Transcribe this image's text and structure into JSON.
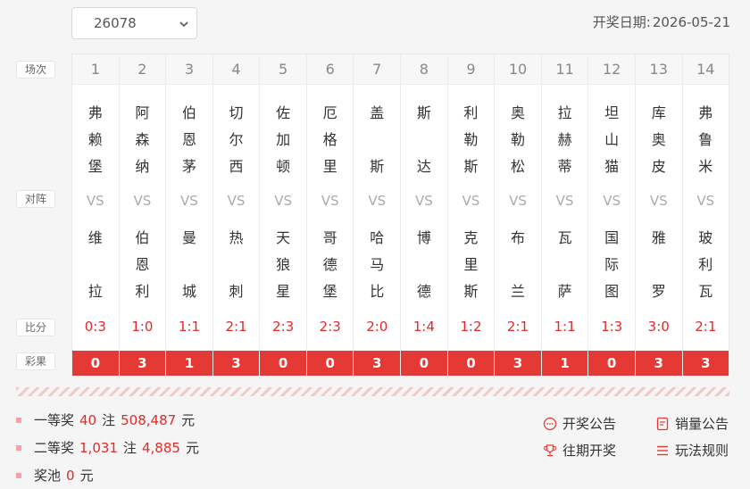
{
  "issue_select": {
    "value": "26078"
  },
  "draw_date": {
    "label": "开奖日期:",
    "value": "2026-05-21"
  },
  "row_labels": {
    "match_no": "场次",
    "matchup": "对阵",
    "score": "比分",
    "result": "彩果"
  },
  "vs_text": "VS",
  "matches": [
    {
      "no": "1",
      "home": [
        "弗",
        "赖",
        "堡"
      ],
      "away": [
        "维",
        "",
        "拉"
      ],
      "score": "0:3",
      "result": "0"
    },
    {
      "no": "2",
      "home": [
        "阿",
        "森",
        "纳"
      ],
      "away": [
        "伯",
        "恩",
        "利"
      ],
      "score": "1:0",
      "result": "3"
    },
    {
      "no": "3",
      "home": [
        "伯",
        "恩",
        "茅"
      ],
      "away": [
        "曼",
        "",
        "城"
      ],
      "score": "1:1",
      "result": "1"
    },
    {
      "no": "4",
      "home": [
        "切",
        "尔",
        "西"
      ],
      "away": [
        "热",
        "",
        "刺"
      ],
      "score": "2:1",
      "result": "3"
    },
    {
      "no": "5",
      "home": [
        "佐",
        "加",
        "顿"
      ],
      "away": [
        "天",
        "狼",
        "星"
      ],
      "score": "2:3",
      "result": "0"
    },
    {
      "no": "6",
      "home": [
        "厄",
        "格",
        "里"
      ],
      "away": [
        "哥",
        "德",
        "堡"
      ],
      "score": "2:3",
      "result": "0"
    },
    {
      "no": "7",
      "home": [
        "盖",
        "",
        "斯"
      ],
      "away": [
        "哈",
        "马",
        "比"
      ],
      "score": "2:0",
      "result": "3"
    },
    {
      "no": "8",
      "home": [
        "斯",
        "",
        "达"
      ],
      "away": [
        "博",
        "",
        "德"
      ],
      "score": "1:4",
      "result": "0"
    },
    {
      "no": "9",
      "home": [
        "利",
        "勒",
        "斯"
      ],
      "away": [
        "克",
        "里",
        "斯"
      ],
      "score": "1:2",
      "result": "0"
    },
    {
      "no": "10",
      "home": [
        "奥",
        "勒",
        "松"
      ],
      "away": [
        "布",
        "",
        "兰"
      ],
      "score": "2:1",
      "result": "3"
    },
    {
      "no": "11",
      "home": [
        "拉",
        "赫",
        "蒂"
      ],
      "away": [
        "瓦",
        "",
        "萨"
      ],
      "score": "1:1",
      "result": "1"
    },
    {
      "no": "12",
      "home": [
        "坦",
        "山",
        "猫"
      ],
      "away": [
        "国",
        "际",
        "图"
      ],
      "score": "1:3",
      "result": "0"
    },
    {
      "no": "13",
      "home": [
        "库",
        "奥",
        "皮"
      ],
      "away": [
        "雅",
        "",
        "罗"
      ],
      "score": "3:0",
      "result": "3"
    },
    {
      "no": "14",
      "home": [
        "弗",
        "鲁",
        "米"
      ],
      "away": [
        "玻",
        "利",
        "瓦"
      ],
      "score": "2:1",
      "result": "3"
    }
  ],
  "prizes": {
    "first": {
      "label": "一等奖",
      "count": "40",
      "unit_count": "注",
      "amount": "508,487",
      "unit_amount": "元"
    },
    "second": {
      "label": "二等奖",
      "count": "1,031",
      "unit_count": "注",
      "amount": "4,885",
      "unit_amount": "元"
    },
    "pool": {
      "label": "奖池",
      "amount": "0",
      "unit_amount": "元"
    }
  },
  "links": {
    "announcement": "开奖公告",
    "sales": "销量公告",
    "history": "往期开奖",
    "rules": "玩法规则"
  },
  "colors": {
    "accent": "#e53935",
    "score_red": "#e02a2a"
  }
}
